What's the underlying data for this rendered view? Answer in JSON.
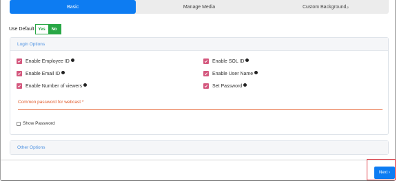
{
  "tabs": [
    {
      "label": "Basic",
      "active": true
    },
    {
      "label": "Manage Media",
      "active": false
    },
    {
      "label": "Custom Background",
      "active": false,
      "superscript": "β"
    }
  ],
  "use_default": {
    "label": "Use Default",
    "yes": "Yes",
    "no": "No",
    "selected": "No"
  },
  "login_options": {
    "title": "Login Options",
    "options": [
      {
        "label": "Enable Employee ID",
        "checked": true,
        "info": true
      },
      {
        "label": "Enable SOL ID",
        "checked": true,
        "info": true
      },
      {
        "label": "Enable Email ID",
        "checked": true,
        "info": true
      },
      {
        "label": "Enable User Name",
        "checked": true,
        "info": true
      },
      {
        "label": "Enable Number of viewers",
        "checked": true,
        "info": true
      },
      {
        "label": "Set Password",
        "checked": true,
        "info": true
      }
    ],
    "password_label": "Common password for webcast *",
    "show_password": "Show Password"
  },
  "other_options": {
    "title": "Other Options"
  },
  "next": {
    "label": "Next ›"
  },
  "colors": {
    "accent": "#0d7cf2",
    "checkbox": "#d4587e",
    "toggle": "#28a745",
    "required": "#e05a2a"
  }
}
